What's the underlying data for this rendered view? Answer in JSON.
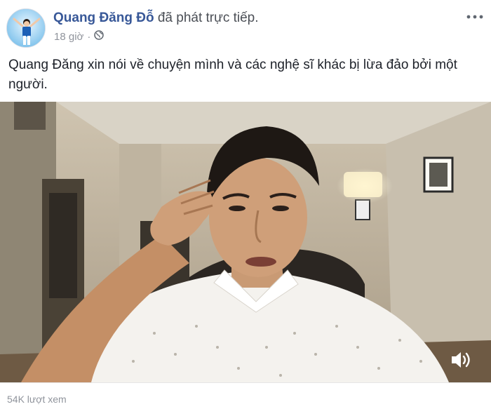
{
  "post": {
    "author_name": "Quang Đăng Đỗ",
    "action_text": "đã phát trực tiếp.",
    "timestamp": "18 giờ",
    "privacy_icon": "globe-icon",
    "more_icon": "more-dots-icon",
    "text": "Quang Đăng xin nói về chuyện mình và các nghệ sĩ khác bị lừa đảo bởi một người."
  },
  "video": {
    "volume_icon": "speaker-icon"
  },
  "footer": {
    "views_text": "54K lượt xem"
  },
  "colors": {
    "link": "#385898",
    "meta": "#90949c",
    "text": "#1d2129"
  }
}
